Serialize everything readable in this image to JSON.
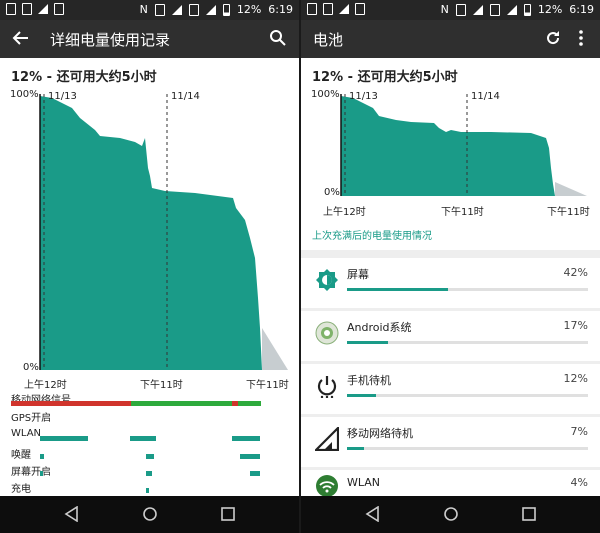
{
  "status_bar": {
    "battery_percent": "12%",
    "time": "6:19",
    "left_icons": [
      "notification-icon",
      "image-icon",
      "wifi-icon",
      "mail-icon"
    ],
    "right_icons": [
      "nfc-icon",
      "vibrate-icon",
      "wifi-icon",
      "no-sim-icon",
      "signal-icon",
      "battery-icon"
    ]
  },
  "left_screen": {
    "title": "详细电量使用记录",
    "back_icon": "arrow-back-icon",
    "search_icon": "search-icon",
    "headline": "12% - 还可用大约5小时",
    "chart": {
      "y_top": "100%",
      "y_bottom": "0%",
      "date_labels": [
        "11/13",
        "11/14"
      ],
      "x_labels": [
        "上午12时",
        "下午11时",
        "下午11时"
      ]
    },
    "signals": [
      {
        "label": "移动网络信号"
      },
      {
        "label": "GPS开启"
      },
      {
        "label": "WLAN"
      },
      {
        "label": "唤醒"
      },
      {
        "label": "屏幕开启"
      },
      {
        "label": "充电"
      }
    ]
  },
  "right_screen": {
    "title": "电池",
    "refresh_icon": "refresh-icon",
    "more_icon": "more-vert-icon",
    "headline": "12% - 还可用大约5小时",
    "chart": {
      "y_top": "100%",
      "y_bottom": "0%",
      "date_labels": [
        "11/13",
        "11/14"
      ],
      "x_labels": [
        "上午12时",
        "下午11时",
        "下午11时"
      ]
    },
    "since_charge_link": "上次充满后的电量使用情况",
    "usage_items": [
      {
        "name": "屏幕",
        "percent": "42%",
        "value": 0.42,
        "icon": "brightness-icon"
      },
      {
        "name": "Android系统",
        "percent": "17%",
        "value": 0.17,
        "icon": "android-system-icon"
      },
      {
        "name": "手机待机",
        "percent": "12%",
        "value": 0.12,
        "icon": "power-icon"
      },
      {
        "name": "移动网络待机",
        "percent": "7%",
        "value": 0.07,
        "icon": "cell-signal-icon"
      },
      {
        "name": "WLAN",
        "percent": "4%",
        "value": 0.04,
        "icon": "wifi-icon"
      }
    ]
  },
  "nav_bar": {
    "buttons": [
      "back-triangle-icon",
      "home-circle-icon",
      "recents-square-icon"
    ]
  },
  "colors": {
    "accent": "#1a9b88",
    "status_bar": "#262626",
    "app_bar": "#2f2f2f",
    "signal_red": "#d0342c",
    "signal_green": "#2eaa3c"
  }
}
